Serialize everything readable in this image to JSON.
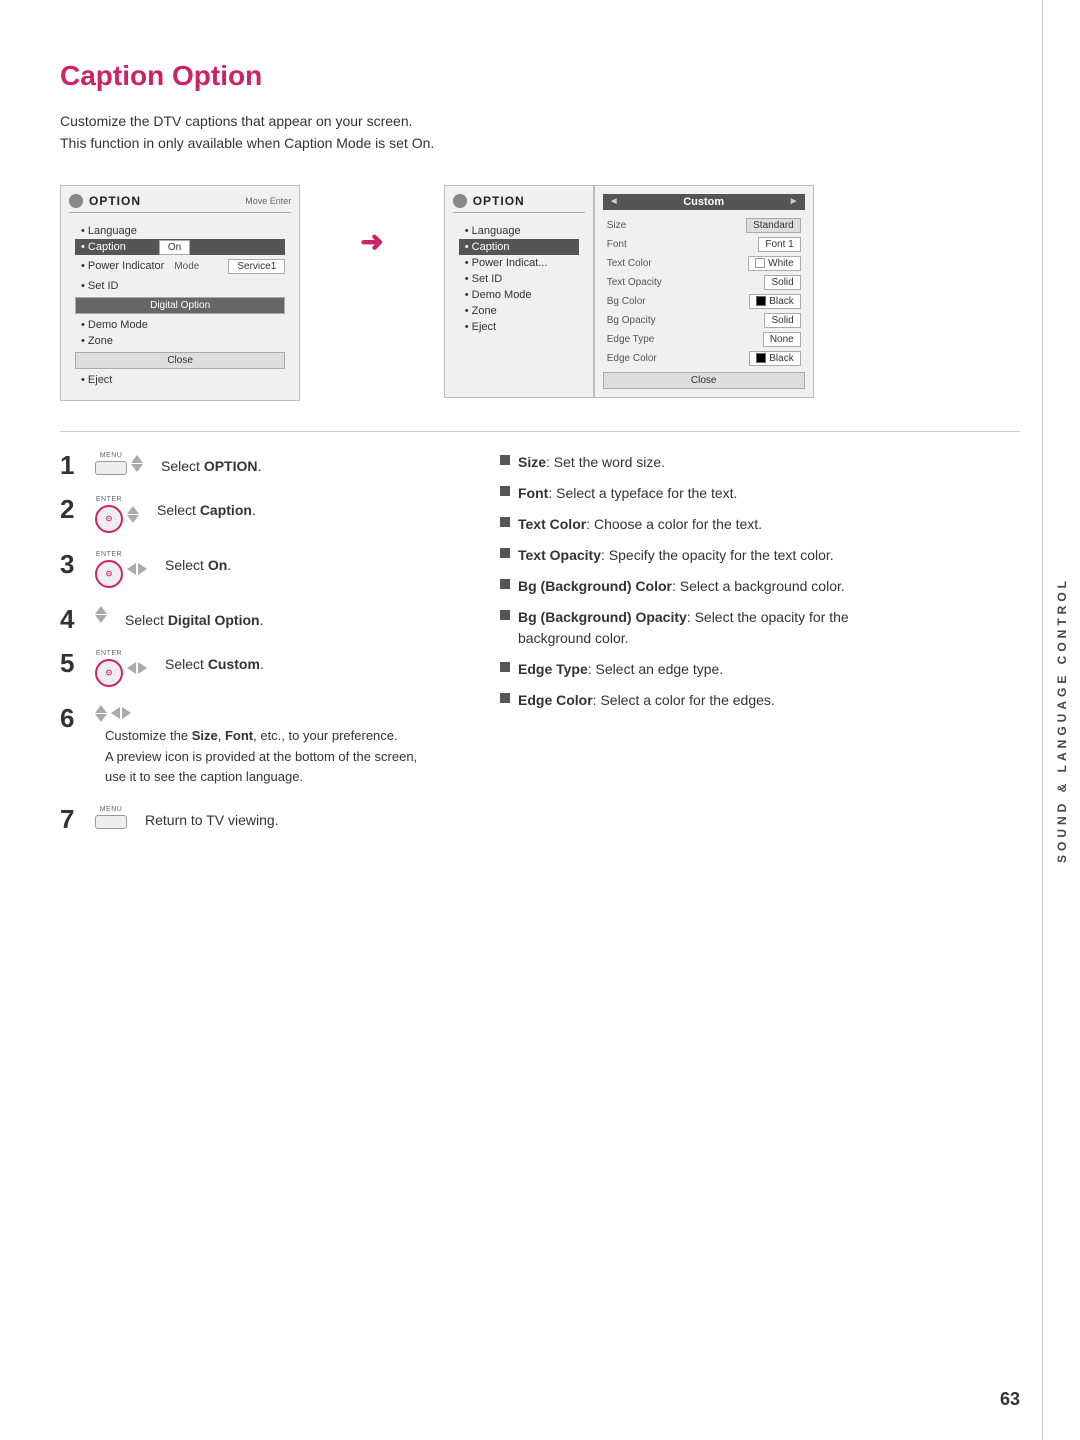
{
  "page": {
    "title": "Caption Option",
    "description_line1": "Customize the DTV captions that appear on your screen.",
    "description_line2": "This function in only available when Caption Mode is set On.",
    "page_number": "63"
  },
  "sidebar": {
    "text": "Sound & Language Control"
  },
  "left_screen": {
    "icon_label": "OPTION",
    "nav": "Move   Enter",
    "menu_items": [
      {
        "label": "Language",
        "active": false
      },
      {
        "label": "Caption",
        "active": true
      },
      {
        "label": "Power Indicator",
        "active": false
      },
      {
        "label": "Set ID",
        "active": false
      },
      {
        "label": "Demo Mode",
        "active": false
      },
      {
        "label": "Zone",
        "active": false
      },
      {
        "label": "Eject",
        "active": false
      }
    ],
    "mode_label": "Mode",
    "mode_value": "Service1",
    "digital_option_btn": "Digital Option",
    "close_btn": "Close"
  },
  "right_screen": {
    "icon_label": "OPTION",
    "menu_items": [
      {
        "label": "Language",
        "active": false
      },
      {
        "label": "Caption",
        "active": true
      },
      {
        "label": "Power Indicator",
        "active": false
      },
      {
        "label": "Set ID",
        "active": false
      },
      {
        "label": "Demo Mode",
        "active": false
      },
      {
        "label": "Zone",
        "active": false
      },
      {
        "label": "Eject",
        "active": false
      }
    ]
  },
  "custom_panel": {
    "nav_left": "◄",
    "title": "Custom",
    "nav_right": "►",
    "options": [
      {
        "label": "Size",
        "value": "Standard",
        "type": "standard",
        "color": null
      },
      {
        "label": "Font",
        "value": "Font 1",
        "type": "text",
        "color": null
      },
      {
        "label": "Text Color",
        "value": "White",
        "type": "color",
        "color": "#ffffff"
      },
      {
        "label": "Text Opacity",
        "value": "Solid",
        "type": "text",
        "color": null
      },
      {
        "label": "Bg Color",
        "value": "Black",
        "type": "color",
        "color": "#000000"
      },
      {
        "label": "Bg Opacity",
        "value": "Solid",
        "type": "text",
        "color": null
      },
      {
        "label": "Edge Type",
        "value": "None",
        "type": "text",
        "color": null
      },
      {
        "label": "Edge Color",
        "value": "Black",
        "type": "color",
        "color": "#000000"
      }
    ],
    "close_btn": "Close"
  },
  "steps": [
    {
      "number": "1",
      "button_type": "menu_updown",
      "text": "Select ",
      "text_bold": "OPTION",
      "text_after": "."
    },
    {
      "number": "2",
      "button_type": "enter_updown",
      "text": "Select ",
      "text_bold": "Caption",
      "text_after": "."
    },
    {
      "number": "3",
      "button_type": "enter_leftright",
      "text": "Select ",
      "text_bold": "On",
      "text_after": "."
    },
    {
      "number": "4",
      "button_type": "updown",
      "text": "Select ",
      "text_bold": "Digital Option",
      "text_after": "."
    },
    {
      "number": "5",
      "button_type": "enter_leftright",
      "text": "Select ",
      "text_bold": "Custom",
      "text_after": "."
    },
    {
      "number": "6",
      "button_type": "updown_leftright",
      "desc": "Customize the ",
      "desc_bold1": "Size",
      "desc_sep1": ", ",
      "desc_bold2": "Font",
      "desc_after": ", etc., to your preference.",
      "desc2": "A preview icon is provided at the bottom of the screen,",
      "desc3": "use it to see the caption language."
    },
    {
      "number": "7",
      "button_type": "menu",
      "text": "Return to TV viewing.",
      "text_bold": ""
    }
  ],
  "bullets": [
    {
      "bold": "Size",
      "text": ": Set the word size."
    },
    {
      "bold": "Font",
      "text": ": Select a typeface for the text."
    },
    {
      "bold": "Text Color",
      "text": ": Choose a color for the text."
    },
    {
      "bold": "Text Opacity",
      "text": ": Specify the opacity for the text color."
    },
    {
      "bold": "Bg (Background) Color",
      "text": ": Select a background color."
    },
    {
      "bold": "Bg (Background) Opacity",
      "text": ": Select the opacity for the background color."
    },
    {
      "bold": "Edge Type",
      "text": ": Select an edge type."
    },
    {
      "bold": "Edge Color",
      "text": ": Select a color for the edges."
    }
  ]
}
